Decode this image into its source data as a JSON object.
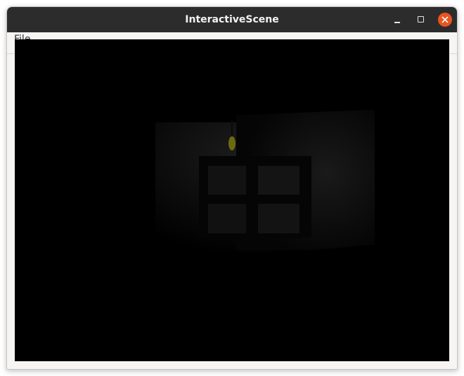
{
  "window": {
    "title": "InteractiveScene",
    "controls": {
      "minimize_icon": "minimize-icon",
      "maximize_icon": "maximize-icon",
      "close_icon": "close-icon",
      "close_color": "#e95420"
    }
  },
  "menubar": {
    "items": [
      {
        "label": "File"
      }
    ]
  },
  "scene": {
    "background": "#000000",
    "light_color": "#6b6a10"
  }
}
